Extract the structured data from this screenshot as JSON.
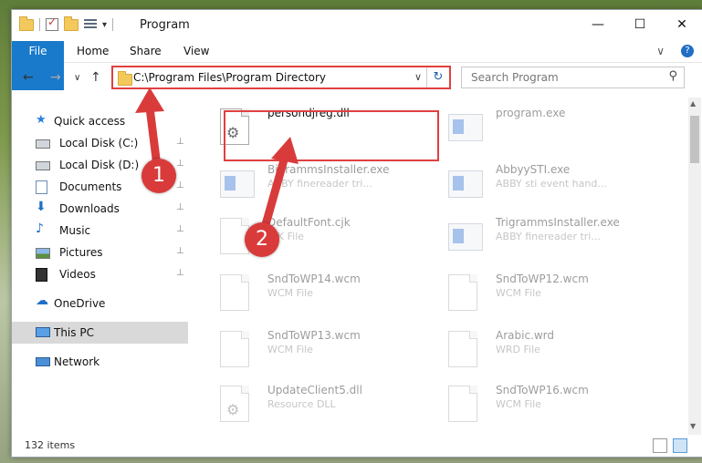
{
  "window": {
    "title": "Program",
    "minimize_glyph": "—",
    "maximize_glyph": "☐",
    "close_glyph": "✕"
  },
  "ribbon": {
    "tabs": [
      "File",
      "Home",
      "Share",
      "View"
    ],
    "expand_glyph": "∨",
    "help_glyph": "?"
  },
  "address": {
    "path": "C:\\Program Files\\Program Directory",
    "dropdown_glyph": "∨",
    "refresh_glyph": "↻"
  },
  "search": {
    "placeholder": "Search Program"
  },
  "nav_buttons": {
    "back": "←",
    "forward": "→",
    "recent": "∨",
    "up": "↑"
  },
  "sidebar": {
    "items": [
      {
        "label": "Quick access",
        "icon": "star-icon",
        "pinned": false
      },
      {
        "label": "Local Disk (C:)",
        "icon": "drive-icon",
        "pinned": true
      },
      {
        "label": "Local Disk (D:)",
        "icon": "drive-icon",
        "pinned": true
      },
      {
        "label": "Documents",
        "icon": "documents-icon",
        "pinned": true
      },
      {
        "label": "Downloads",
        "icon": "download-icon",
        "pinned": true
      },
      {
        "label": "Music",
        "icon": "music-icon",
        "pinned": true
      },
      {
        "label": "Pictures",
        "icon": "pictures-icon",
        "pinned": true
      },
      {
        "label": "Videos",
        "icon": "videos-icon",
        "pinned": true
      },
      {
        "label": "OneDrive",
        "icon": "cloud-icon",
        "pinned": false
      },
      {
        "label": "This PC",
        "icon": "computer-icon",
        "pinned": false,
        "selected": true
      },
      {
        "label": "Network",
        "icon": "network-icon",
        "pinned": false
      }
    ],
    "pin_glyph": "📌"
  },
  "files": [
    {
      "name": "persondjreg.dll",
      "type": "",
      "icon": "dll-gear-icon",
      "highlighted": true
    },
    {
      "name": "program.exe",
      "type": "",
      "icon": "exe-icon"
    },
    {
      "name": "BigrammsInstaller.exe",
      "type": "ABBY finereader tri...",
      "icon": "exe-icon"
    },
    {
      "name": "AbbyySTI.exe",
      "type": "ABBY sti event hand...",
      "icon": "exe-icon"
    },
    {
      "name": "DefaultFont.cjk",
      "type": "CJK File",
      "icon": "file-icon"
    },
    {
      "name": "TrigrammsInstaller.exe",
      "type": "ABBY finereader tri...",
      "icon": "exe-icon"
    },
    {
      "name": "SndToWP14.wcm",
      "type": "WCM File",
      "icon": "file-icon"
    },
    {
      "name": "SndToWP12.wcm",
      "type": "WCM File",
      "icon": "file-icon"
    },
    {
      "name": "SndToWP13.wcm",
      "type": "WCM File",
      "icon": "file-icon"
    },
    {
      "name": "Arabic.wrd",
      "type": "WRD File",
      "icon": "file-icon"
    },
    {
      "name": "UpdateClient5.dll",
      "type": "Resource DLL",
      "icon": "dll-gear-icon"
    },
    {
      "name": "SndToWP16.wcm",
      "type": "WCM File",
      "icon": "file-icon"
    }
  ],
  "status": {
    "item_count": "132 items"
  },
  "annotations": {
    "step1": "1",
    "step2": "2"
  },
  "colors": {
    "accent": "#1979ca",
    "highlight_border": "#e04040",
    "marker": "#d93b3b"
  }
}
